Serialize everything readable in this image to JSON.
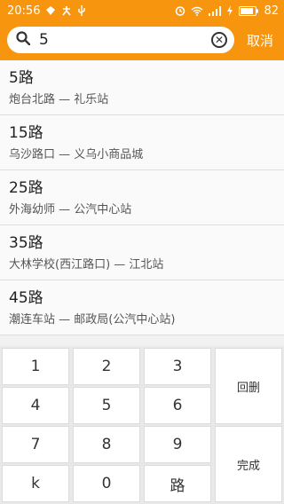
{
  "status": {
    "time": "20:56",
    "battery": "82"
  },
  "search": {
    "value": "5",
    "cancel_label": "取消"
  },
  "results": [
    {
      "name": "5路",
      "route": "炮台北路 — 礼乐站"
    },
    {
      "name": "15路",
      "route": "乌沙路口 — 义乌小商品城"
    },
    {
      "name": "25路",
      "route": "外海幼师 — 公汽中心站"
    },
    {
      "name": "35路",
      "route": "大林学校(西江路口) — 江北站"
    },
    {
      "name": "45路",
      "route": "潮连车站 — 邮政局(公汽中心站)"
    }
  ],
  "keypad": {
    "k1": "1",
    "k2": "2",
    "k3": "3",
    "k4": "4",
    "k5": "5",
    "k6": "6",
    "k7": "7",
    "k8": "8",
    "k9": "9",
    "kk": "k",
    "k0": "0",
    "klu": "路",
    "backspace": "回删",
    "done": "完成"
  },
  "colors": {
    "accent": "#f8950f"
  }
}
